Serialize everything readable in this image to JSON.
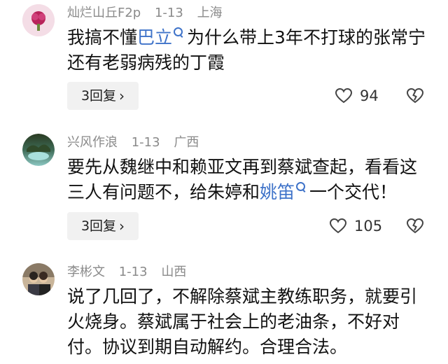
{
  "comments": [
    {
      "user": "灿烂山丘F2p",
      "date": "1-13",
      "location": "上海",
      "text_before": "我搞不懂",
      "mention": "巴立",
      "text_after": "为什么带上3年不打球的张常宁还有老弱病残的丁霞",
      "reply_label": "3回复",
      "likes": "94"
    },
    {
      "user": "兴风作浪",
      "date": "1-13",
      "location": "广西",
      "text_before": "要先从魏继中和赖亚文再到蔡斌查起，看看这三人有问题不，给朱婷和",
      "mention": "姚笛",
      "text_after": "一个交代！",
      "reply_label": "3回复",
      "likes": "105"
    },
    {
      "user": "李彬文",
      "date": "1-13",
      "location": "山西",
      "text": "说了几回了，不解除蔡斌主教练职务，就要引火烧身。蔡斌属于社会上的老油条，不好对付。协议到期自动解约。合理合法。"
    }
  ],
  "icons": {
    "like": "heart-outline-icon",
    "dislike": "broken-heart-icon",
    "mention_search": "search-icon",
    "reply_chevron": "chevron-right-icon"
  },
  "colors": {
    "mention": "#3f73c9",
    "meta": "#8a8a8a",
    "reply_bg": "#f1f1f1"
  }
}
